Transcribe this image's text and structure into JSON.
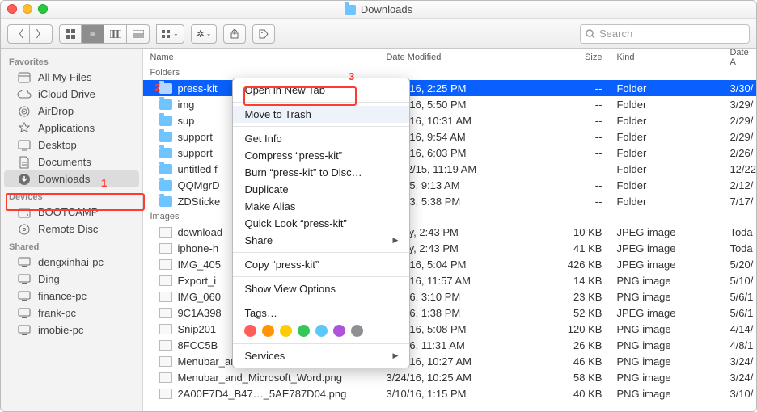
{
  "window": {
    "title": "Downloads"
  },
  "search": {
    "placeholder": "Search"
  },
  "sidebar": {
    "sections": [
      {
        "title": "Favorites",
        "items": [
          {
            "label": "All My Files",
            "icon": "all-files-icon"
          },
          {
            "label": "iCloud Drive",
            "icon": "cloud-icon"
          },
          {
            "label": "AirDrop",
            "icon": "airdrop-icon"
          },
          {
            "label": "Applications",
            "icon": "applications-icon"
          },
          {
            "label": "Desktop",
            "icon": "desktop-icon"
          },
          {
            "label": "Documents",
            "icon": "documents-icon"
          },
          {
            "label": "Downloads",
            "icon": "downloads-icon",
            "selected": true
          }
        ]
      },
      {
        "title": "Devices",
        "items": [
          {
            "label": "BOOTCAMP",
            "icon": "disk-icon"
          },
          {
            "label": "Remote Disc",
            "icon": "disc-icon"
          }
        ]
      },
      {
        "title": "Shared",
        "items": [
          {
            "label": "dengxinhai-pc",
            "icon": "pc-icon"
          },
          {
            "label": "Ding",
            "icon": "pc-icon"
          },
          {
            "label": "finance-pc",
            "icon": "pc-icon"
          },
          {
            "label": "frank-pc",
            "icon": "pc-icon"
          },
          {
            "label": "imobie-pc",
            "icon": "pc-icon"
          }
        ]
      }
    ]
  },
  "columns": {
    "name": "Name",
    "date": "Date Modified",
    "size": "Size",
    "kind": "Kind",
    "date_added": "Date A"
  },
  "groups": [
    {
      "label": "Folders",
      "rows": [
        {
          "name": "press-kit",
          "date": "3/30/16, 2:25 PM",
          "size": "--",
          "kind": "Folder",
          "da": "3/30/",
          "selected": true,
          "type": "folder"
        },
        {
          "name": "img",
          "date": "3/29/16, 5:50 PM",
          "size": "--",
          "kind": "Folder",
          "da": "3/29/",
          "type": "folder"
        },
        {
          "name": "sup",
          "date": "3/29/16, 10:31 AM",
          "size": "--",
          "kind": "Folder",
          "da": "2/29/",
          "type": "folder"
        },
        {
          "name": "support",
          "date": "3/29/16, 9:54 AM",
          "size": "--",
          "kind": "Folder",
          "da": "2/29/",
          "type": "folder"
        },
        {
          "name": "support",
          "date": "3/25/16, 6:03 PM",
          "size": "--",
          "kind": "Folder",
          "da": "2/26/",
          "type": "folder"
        },
        {
          "name": "untitled f",
          "date": "12/22/15, 11:19 AM",
          "size": "--",
          "kind": "Folder",
          "da": "12/22",
          "type": "folder"
        },
        {
          "name": "QQMgrD",
          "date": "9/7/15, 9:13 AM",
          "size": "--",
          "kind": "Folder",
          "da": "2/12/",
          "type": "folder"
        },
        {
          "name": "ZDSticke",
          "date": "8/7/13, 5:38 PM",
          "size": "--",
          "kind": "Folder",
          "da": "7/17/",
          "type": "folder"
        }
      ]
    },
    {
      "label": "Images",
      "rows": [
        {
          "name": "download",
          "date": "Today, 2:43 PM",
          "size": "10 KB",
          "kind": "JPEG image",
          "da": "Toda",
          "type": "image"
        },
        {
          "name": "iphone-h",
          "date": "Today, 2:43 PM",
          "size": "41 KB",
          "kind": "JPEG image",
          "da": "Toda",
          "type": "image"
        },
        {
          "name": "IMG_405",
          "date": "5/20/16, 5:04 PM",
          "size": "426 KB",
          "kind": "JPEG image",
          "da": "5/20/",
          "type": "image"
        },
        {
          "name": "Export_i",
          "date": "5/10/16, 11:57 AM",
          "size": "14 KB",
          "kind": "PNG image",
          "da": "5/10/",
          "type": "image"
        },
        {
          "name": "IMG_060",
          "date": "3/4/16, 3:10 PM",
          "size": "23 KB",
          "kind": "PNG image",
          "da": "5/6/1",
          "type": "image"
        },
        {
          "name": "9C1A398",
          "date": "5/6/16, 1:38 PM",
          "size": "52 KB",
          "kind": "JPEG image",
          "da": "5/6/1",
          "type": "image"
        },
        {
          "name": "Snip201",
          "date": "4/14/16, 5:08 PM",
          "size": "120 KB",
          "kind": "PNG image",
          "da": "4/14/",
          "type": "image"
        },
        {
          "name": "8FCC5B",
          "date": "4/8/16, 11:31 AM",
          "size": "26 KB",
          "kind": "PNG image",
          "da": "4/8/1",
          "type": "image"
        },
        {
          "name": "Menubar_and_…soft_Word-1.png",
          "date": "3/24/16, 10:27 AM",
          "size": "46 KB",
          "kind": "PNG image",
          "da": "3/24/",
          "type": "image"
        },
        {
          "name": "Menubar_and_Microsoft_Word.png",
          "date": "3/24/16, 10:25 AM",
          "size": "58 KB",
          "kind": "PNG image",
          "da": "3/24/",
          "type": "image"
        },
        {
          "name": "2A00E7D4_B47…_5AE787D04.png",
          "date": "3/10/16, 1:15 PM",
          "size": "40 KB",
          "kind": "PNG image",
          "da": "3/10/",
          "type": "image"
        }
      ]
    }
  ],
  "context_menu": {
    "items": [
      {
        "label": "Open in New Tab"
      },
      {
        "sep": true
      },
      {
        "label": "Move to Trash",
        "highlighted": true
      },
      {
        "sep": true
      },
      {
        "label": "Get Info"
      },
      {
        "label": "Compress “press-kit”"
      },
      {
        "label": "Burn “press-kit” to Disc…"
      },
      {
        "label": "Duplicate"
      },
      {
        "label": "Make Alias"
      },
      {
        "label": "Quick Look “press-kit”"
      },
      {
        "label": "Share",
        "submenu": true
      },
      {
        "sep": true
      },
      {
        "label": "Copy “press-kit”"
      },
      {
        "sep": true
      },
      {
        "label": "Show View Options"
      },
      {
        "sep": true
      },
      {
        "label": "Tags…"
      },
      {
        "tags": true
      },
      {
        "sep": true
      },
      {
        "label": "Services",
        "submenu": true
      }
    ],
    "tag_colors": [
      "#ff5f57",
      "#ff9500",
      "#ffcc00",
      "#34c759",
      "#5ac8fa",
      "#af52de",
      "#8e8e93"
    ]
  },
  "annotations": {
    "1": "1",
    "2": "2",
    "3": "3"
  }
}
